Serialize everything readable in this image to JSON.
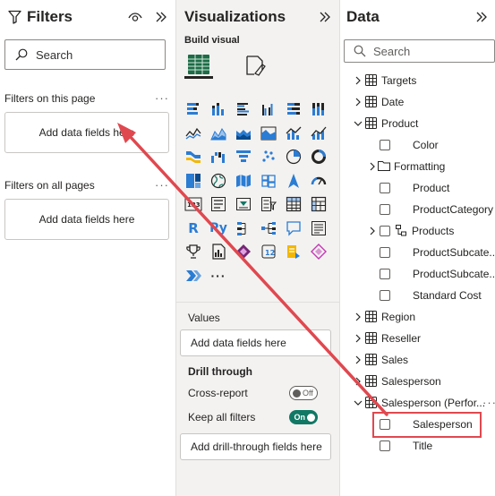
{
  "filters": {
    "title": "Filters",
    "search_placeholder": "Search",
    "page_section": "Filters on this page",
    "page_well": "Add data fields here",
    "all_section": "Filters on all pages",
    "all_well": "Add data fields here",
    "more": "···"
  },
  "viz": {
    "title": "Visualizations",
    "build_label": "Build visual",
    "more_visuals": "···",
    "values_label": "Values",
    "values_well": "Add data fields here",
    "drill_label": "Drill through",
    "cross_report_label": "Cross-report",
    "cross_report_state": "Off",
    "keep_filters_label": "Keep all filters",
    "keep_filters_state": "On",
    "drill_well": "Add drill-through fields here",
    "r_label": "R",
    "py_label": "Py"
  },
  "data": {
    "title": "Data",
    "search_placeholder": "Search",
    "more": "···",
    "items": [
      {
        "label": "Targets",
        "kind": "table",
        "level": 0,
        "expand": "collapsed"
      },
      {
        "label": "Date",
        "kind": "table",
        "level": 0,
        "expand": "collapsed"
      },
      {
        "label": "Product",
        "kind": "table",
        "level": 0,
        "expand": "expanded"
      },
      {
        "label": "Color",
        "kind": "field",
        "level": 1
      },
      {
        "label": "Formatting",
        "kind": "folder",
        "level": 1,
        "expand": "collapsed"
      },
      {
        "label": "Product",
        "kind": "field",
        "level": 1
      },
      {
        "label": "ProductCategory",
        "kind": "field",
        "level": 1
      },
      {
        "label": "Products",
        "kind": "hierarchy",
        "level": 1,
        "expand": "collapsed"
      },
      {
        "label": "ProductSubcate...",
        "kind": "field",
        "level": 1
      },
      {
        "label": "ProductSubcate...",
        "kind": "field",
        "level": 1
      },
      {
        "label": "Standard Cost",
        "kind": "field",
        "level": 1
      },
      {
        "label": "Region",
        "kind": "table",
        "level": 0,
        "expand": "collapsed"
      },
      {
        "label": "Reseller",
        "kind": "table",
        "level": 0,
        "expand": "collapsed"
      },
      {
        "label": "Sales",
        "kind": "table",
        "level": 0,
        "expand": "collapsed"
      },
      {
        "label": "Salesperson",
        "kind": "table",
        "level": 0,
        "expand": "collapsed"
      },
      {
        "label": "Salesperson (Perfor...",
        "kind": "table",
        "level": 0,
        "expand": "expanded"
      },
      {
        "label": "Salesperson",
        "kind": "field",
        "level": 1
      },
      {
        "label": "Title",
        "kind": "field",
        "level": 1
      }
    ]
  },
  "colors": {
    "annotation": "#e0484f",
    "toggle_on": "#117865",
    "accent_blue": "#2b7cd3"
  }
}
